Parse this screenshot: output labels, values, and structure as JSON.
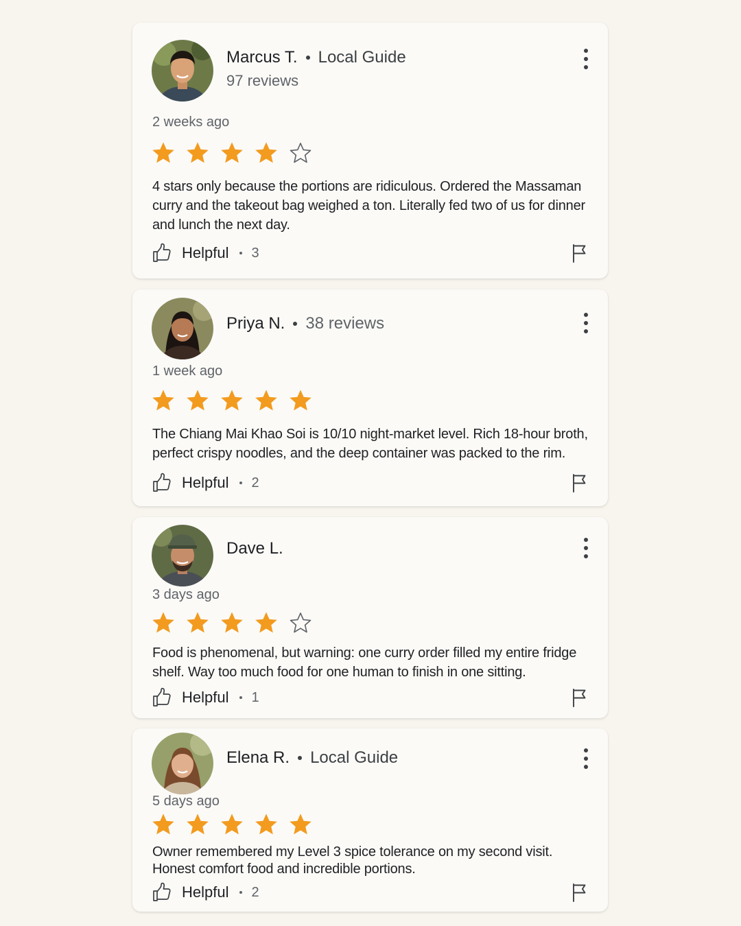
{
  "reviews": [
    {
      "name": "Marcus T.",
      "tag": "Local Guide",
      "subline": "97 reviews",
      "date": "2 weeks ago",
      "rating": 4,
      "text": "4 stars only because the portions are ridiculous. Ordered the Massaman curry and the takeout bag weighed a ton. Literally fed two of us for dinner and lunch the next day.",
      "helpful_label": "Helpful",
      "helpful_count": "3"
    },
    {
      "name": "Priya N.",
      "tag": "38 reviews",
      "date": "1 week ago",
      "rating": 5,
      "text": "The Chiang Mai Khao Soi is 10/10 night-market level. Rich 18-hour broth, perfect crispy noodles, and the deep container was packed to the rim.",
      "helpful_label": "Helpful",
      "helpful_count": "2"
    },
    {
      "name": "Dave L.",
      "date": "3 days ago",
      "rating": 4,
      "text": "Food is phenomenal, but warning: one curry order filled my entire fridge shelf. Way too much food for one human to finish in one sitting.",
      "helpful_label": "Helpful",
      "helpful_count": "1"
    },
    {
      "name": "Elena R.",
      "tag": "Local Guide",
      "date": "5 days ago",
      "rating": 5,
      "text": "Owner remembered my Level 3 spice tolerance on my second visit. Honest comfort food and incredible portions.",
      "helpful_label": "Helpful",
      "helpful_count": "2"
    }
  ],
  "colors": {
    "star_filled": "#f29b1f",
    "star_empty": "#5f6368",
    "background": "#f8f5ee",
    "card": "#fbfaf7"
  },
  "icons": {
    "menu": "more-vert-icon",
    "helpful": "thumbs-up-icon",
    "report": "flag-icon",
    "star": "star-icon"
  }
}
